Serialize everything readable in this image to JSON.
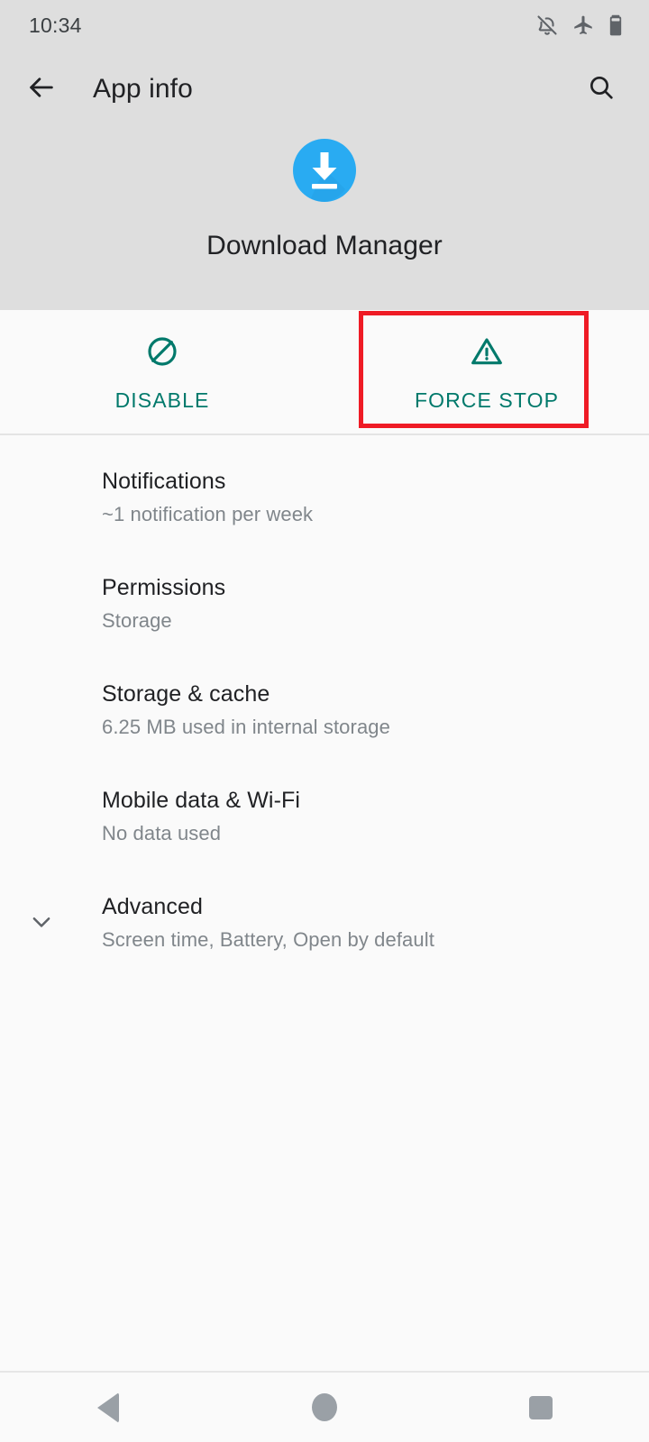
{
  "status_bar": {
    "time": "10:34",
    "icons": [
      "notifications-off-icon",
      "airplane-mode-icon",
      "battery-icon"
    ]
  },
  "app_bar": {
    "back_icon": "arrow-back-icon",
    "title": "App info",
    "search_icon": "search-icon"
  },
  "app_header": {
    "icon_name": "download-manager-icon",
    "icon_color": "#29abf2",
    "app_name": "Download Manager"
  },
  "actions": {
    "accent_color": "#00796b",
    "highlight_color": "#ef1b25",
    "buttons": [
      {
        "label": "DISABLE",
        "icon": "block-circle-slash-icon",
        "highlighted": false
      },
      {
        "label": "FORCE STOP",
        "icon": "warning-triangle-icon",
        "highlighted": true
      }
    ]
  },
  "settings": {
    "items": [
      {
        "title": "Notifications",
        "subtitle": "~1 notification per week",
        "chevron": false
      },
      {
        "title": "Permissions",
        "subtitle": "Storage",
        "chevron": false
      },
      {
        "title": "Storage & cache",
        "subtitle": "6.25 MB used in internal storage",
        "chevron": false
      },
      {
        "title": "Mobile data & Wi-Fi",
        "subtitle": "No data used",
        "chevron": false
      },
      {
        "title": "Advanced",
        "subtitle": "Screen time, Battery, Open by default",
        "chevron": true
      }
    ]
  },
  "nav_bar": {
    "back_label": "Back",
    "home_label": "Home",
    "recents_label": "Recents"
  }
}
